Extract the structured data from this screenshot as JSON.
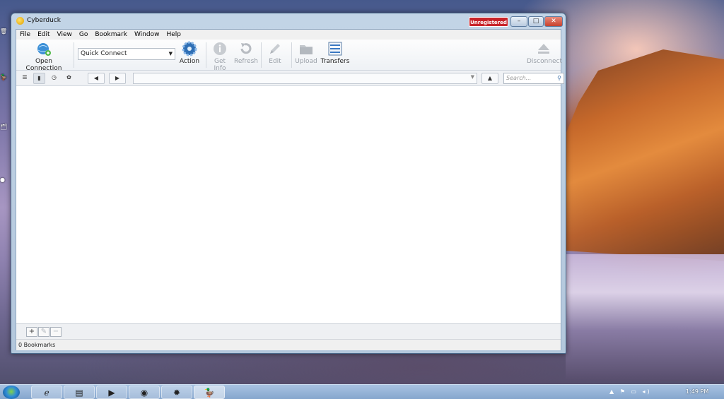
{
  "window": {
    "title": "Cyberduck",
    "badge": "Unregistered",
    "controls": {
      "minimize": "–",
      "maximize": "□",
      "close": "✕"
    }
  },
  "menu": [
    "File",
    "Edit",
    "View",
    "Go",
    "Bookmark",
    "Window",
    "Help"
  ],
  "toolbar": {
    "open_connection": "Open Connection",
    "quick_connect": "Quick Connect",
    "action": "Action",
    "get_info": "Get Info",
    "refresh": "Refresh",
    "edit": "Edit",
    "upload": "Upload",
    "transfers": "Transfers",
    "disconnect": "Disconnect"
  },
  "navbar": {
    "back": "◀",
    "forward": "▶",
    "path_value": "",
    "up": "▲",
    "search_placeholder": "Search..."
  },
  "bottom": {
    "add": "+",
    "edit": "✎",
    "remove": "−"
  },
  "status": {
    "text": "0 Bookmarks"
  },
  "taskbar": {
    "time": "1:49 PM"
  },
  "colors": {
    "badge": "#c8242a",
    "window_frame": "#b3c7dc",
    "taskbar": "#86a6cd"
  }
}
